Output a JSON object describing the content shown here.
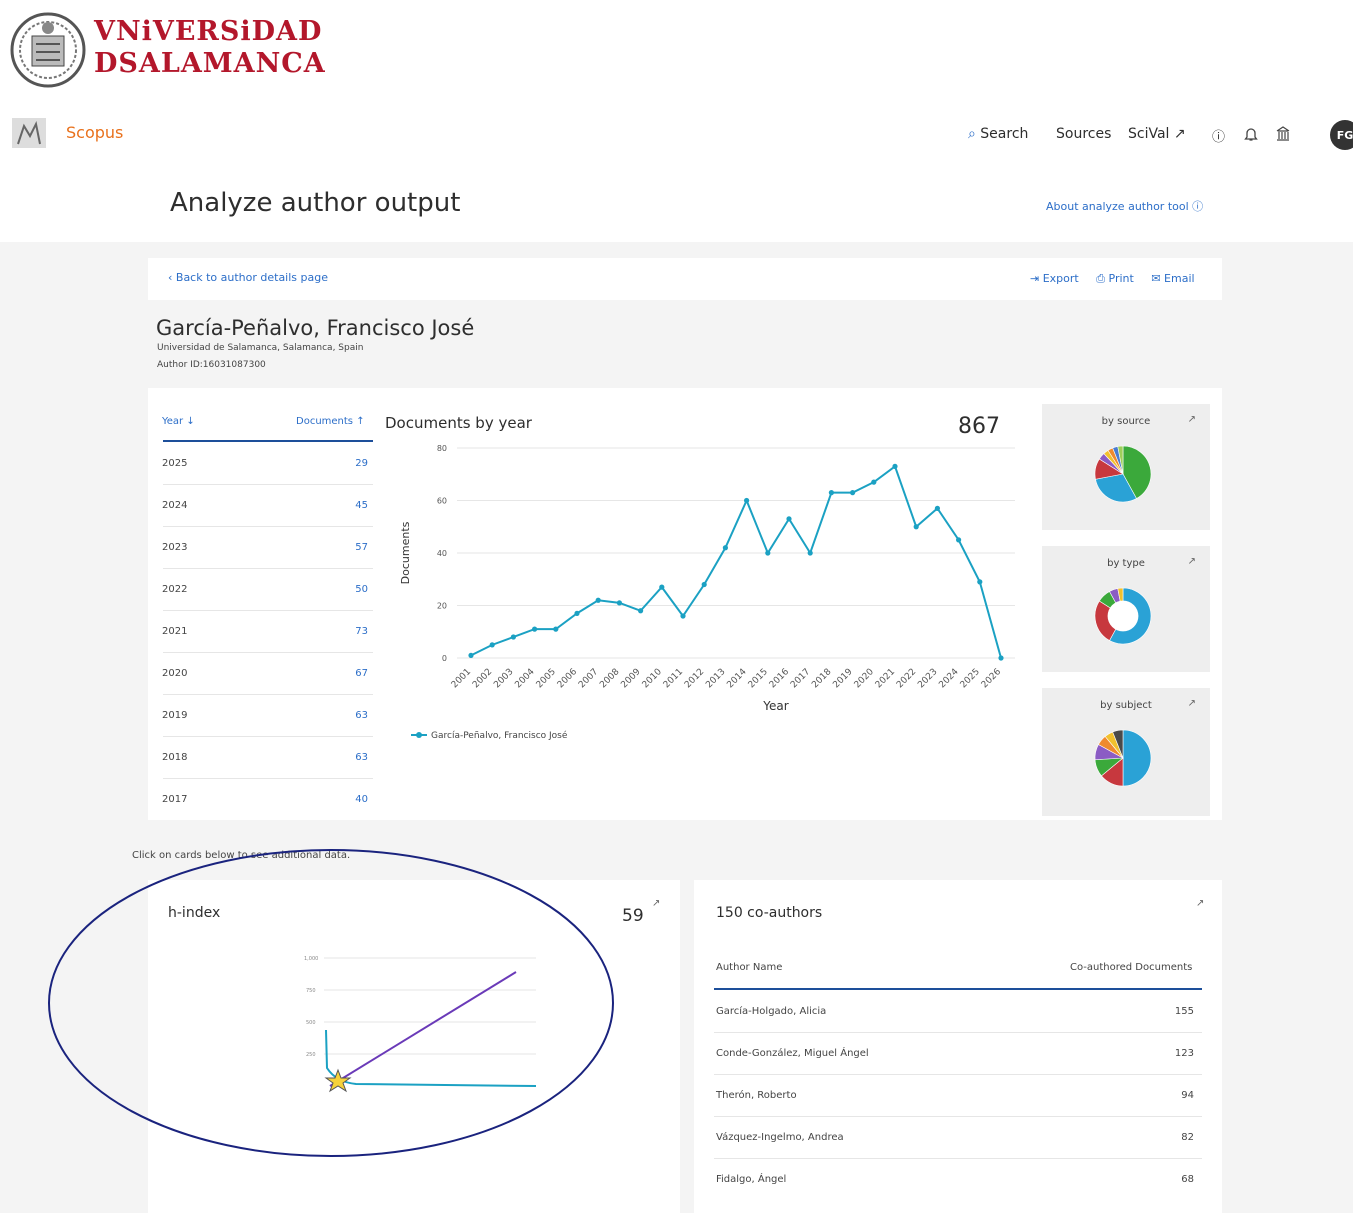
{
  "header": {
    "university_line1": "VNiVERSiDAD",
    "university_line2": "DSALAMANCA",
    "app_name": "Scopus",
    "nav": {
      "search": "Search",
      "sources": "Sources",
      "scival": "SciVal ↗",
      "avatar_initials": "FG"
    }
  },
  "page": {
    "title": "Analyze author output",
    "about_link": "About analyze author tool ⓘ",
    "back_link": "‹ Back to author details page",
    "actions": {
      "export": "Export",
      "print": "Print",
      "email": "Email"
    }
  },
  "author": {
    "name": "García-Peñalvo, Francisco José",
    "affiliation": "Universidad de Salamanca, Salamanca, Spain",
    "author_id": "Author ID:16031087300"
  },
  "year_table": {
    "col_year": "Year ↓",
    "col_docs": "Documents ↑",
    "rows": [
      {
        "year": "2025",
        "docs": "29"
      },
      {
        "year": "2024",
        "docs": "45"
      },
      {
        "year": "2023",
        "docs": "57"
      },
      {
        "year": "2022",
        "docs": "50"
      },
      {
        "year": "2021",
        "docs": "73"
      },
      {
        "year": "2020",
        "docs": "67"
      },
      {
        "year": "2019",
        "docs": "63"
      },
      {
        "year": "2018",
        "docs": "63"
      },
      {
        "year": "2017",
        "docs": "40"
      }
    ]
  },
  "docs_chart": {
    "title": "Documents by year",
    "total": "867"
  },
  "chart_data": [
    {
      "type": "line",
      "title": "Documents by year",
      "xlabel": "Year",
      "ylabel": "Documents",
      "ylim": [
        0,
        80
      ],
      "yticks": [
        "0",
        "20",
        "40",
        "60",
        "80"
      ],
      "x": [
        "2001",
        "2002",
        "2003",
        "2004",
        "2005",
        "2006",
        "2007",
        "2008",
        "2009",
        "2010",
        "2011",
        "2012",
        "2013",
        "2014",
        "2015",
        "2016",
        "2017",
        "2018",
        "2019",
        "2020",
        "2021",
        "2022",
        "2023",
        "2024",
        "2025",
        "2026"
      ],
      "series": [
        {
          "name": "García-Peñalvo, Francisco José",
          "color": "#1ba1c3",
          "values": [
            1,
            5,
            8,
            11,
            11,
            17,
            22,
            21,
            18,
            27,
            16,
            28,
            42,
            60,
            40,
            53,
            40,
            63,
            63,
            67,
            73,
            50,
            57,
            45,
            29,
            0
          ]
        }
      ],
      "grid": true,
      "legend": "bottom-left"
    },
    {
      "type": "pie",
      "title": "by source",
      "slices": [
        {
          "value": 42,
          "color": "#3ba93b"
        },
        {
          "value": 30,
          "color": "#2aa2d6"
        },
        {
          "value": 12,
          "color": "#c7383e"
        },
        {
          "value": 4,
          "color": "#8b5cc4"
        },
        {
          "value": 3,
          "color": "#f2c12e"
        },
        {
          "value": 3,
          "color": "#ef8a2e"
        },
        {
          "value": 3,
          "color": "#4a7bd0"
        },
        {
          "value": 3,
          "color": "#9ecf5a"
        }
      ]
    },
    {
      "type": "pie",
      "title": "by type",
      "donut": true,
      "slices": [
        {
          "value": 58,
          "color": "#2aa2d6"
        },
        {
          "value": 26,
          "color": "#c7383e"
        },
        {
          "value": 8,
          "color": "#3ba93b"
        },
        {
          "value": 5,
          "color": "#8b5cc4"
        },
        {
          "value": 3,
          "color": "#f2c12e"
        }
      ]
    },
    {
      "type": "pie",
      "title": "by subject",
      "slices": [
        {
          "value": 50,
          "color": "#2aa2d6"
        },
        {
          "value": 14,
          "color": "#c7383e"
        },
        {
          "value": 10,
          "color": "#3ba93b"
        },
        {
          "value": 9,
          "color": "#8b5cc4"
        },
        {
          "value": 6,
          "color": "#ef8a2e"
        },
        {
          "value": 5,
          "color": "#f2c12e"
        },
        {
          "value": 6,
          "color": "#4a4a4a"
        }
      ]
    }
  ],
  "side_cards": {
    "source": "by source",
    "type": "by type",
    "subject": "by subject"
  },
  "click_note": "Click on cards below to see additional data.",
  "h_index": {
    "title": "h-index",
    "value": "59"
  },
  "coauthors": {
    "title": "150 co-authors",
    "col_name": "Author Name",
    "col_docs": "Co-authored Documents",
    "rows": [
      {
        "name": "García-Holgado, Alicia",
        "docs": "155"
      },
      {
        "name": "Conde-González, Miguel Ángel",
        "docs": "123"
      },
      {
        "name": "Therón, Roberto",
        "docs": "94"
      },
      {
        "name": "Vázquez-Ingelmo, Andrea",
        "docs": "82"
      },
      {
        "name": "Fidalgo, Ángel",
        "docs": "68"
      }
    ]
  },
  "colors": {
    "accent": "#2c6ec8",
    "scopus": "#e9711c",
    "university": "#b3172b",
    "line": "#1ba1c3",
    "annotation": "#1a237e"
  }
}
